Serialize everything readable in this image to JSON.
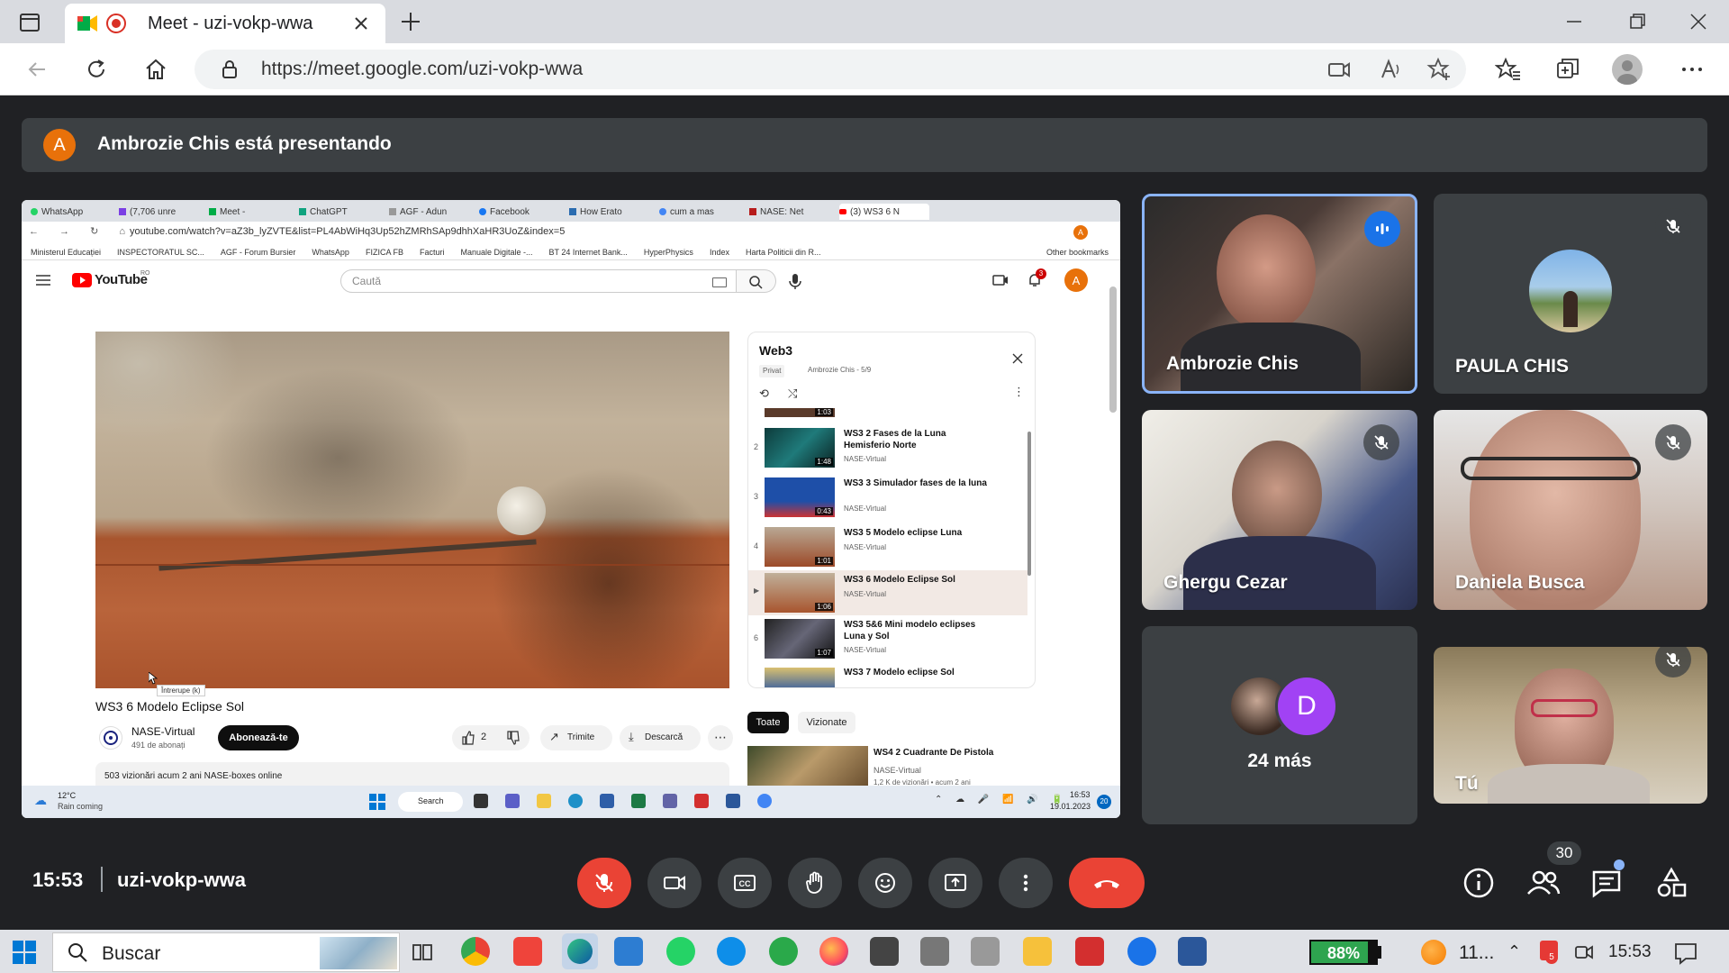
{
  "browser": {
    "tab_title": "Meet - uzi-vokp-wwa",
    "url": "https://meet.google.com/uzi-vokp-wwa"
  },
  "banner": {
    "avatar_letter": "A",
    "text": "Ambrozie Chis está presentando"
  },
  "shared_screen": {
    "tabs": [
      "WhatsApp",
      "(7,706 unre",
      "Meet -",
      "ChatGPT",
      "AGF - Adun",
      "Facebook",
      "How Erato",
      "cum a mas",
      "NASE: Net",
      "(3) WS3 6 N"
    ],
    "url": "youtube.com/watch?v=aZ3b_lyZVTE&list=PL4AbWiHq3Up52hZMRhSAp9dhhXaHR3UoZ&index=5",
    "bookmarks": [
      "Ministerul Educației",
      "INSPECTORATUL SC...",
      "AGF - Forum Bursier",
      "WhatsApp",
      "FIZICA FB",
      "Facturi",
      "Manuale Digitale -...",
      "BT 24 Internet Bank...",
      "HyperPhysics",
      "Index",
      "Harta Politicii din R..."
    ],
    "other_bookmarks": "Other bookmarks",
    "youtube_logo": "YouTube",
    "youtube_region": "RO",
    "search_placeholder": "Caută",
    "account_letter": "A",
    "notif_count": "3",
    "tooltip": "Întrerupe (k)",
    "video_title": "WS3 6 Modelo Eclipse Sol",
    "channel": "NASE-Virtual",
    "subscribers": "491 de abonați",
    "subscribe": "Abonează-te",
    "likes": "2",
    "share": "Trimite",
    "download": "Descarcă",
    "views": "503 vizionări  acum 2 ani  NASE-boxes online",
    "playlist": {
      "title": "Web3",
      "privacy": "Privat",
      "owner": "Ambrozie Chis - 5/9",
      "top_duration": "1:03",
      "items": [
        {
          "index": "2",
          "title": "WS3 2 Fases de la Luna Hemisferio Norte",
          "channel": "NASE-Virtual",
          "duration": "1:48"
        },
        {
          "index": "3",
          "title": "WS3 3 Simulador fases de la luna",
          "channel": "NASE-Virtual",
          "duration": "0:43"
        },
        {
          "index": "4",
          "title": "WS3 5 Modelo eclipse Luna",
          "channel": "NASE-Virtual",
          "duration": "1:01"
        },
        {
          "index": "▶",
          "title": "WS3 6 Modelo Eclipse Sol",
          "channel": "NASE-Virtual",
          "duration": "1:06"
        },
        {
          "index": "6",
          "title": "WS3 5&6 Mini modelo eclipses Luna y Sol",
          "channel": "NASE-Virtual",
          "duration": "1:07"
        },
        {
          "index": "7",
          "title": "WS3 7 Modelo eclipse Sol",
          "channel": "",
          "duration": ""
        }
      ]
    },
    "filter_all": "Toate",
    "filter_watched": "Vizionate",
    "related_title": "WS4 2 Cuadrante De Pistola",
    "related_channel": "NASE-Virtual",
    "related_meta": "1,2 K de vizionări • acum 2 ani",
    "weather_temp": "12°C",
    "weather_text": "Rain coming",
    "win_search": "Search",
    "clock_time": "16:53",
    "clock_date": "19.01.2023",
    "notif_badge": "20"
  },
  "participants": {
    "p1": "Ambrozie Chis",
    "p2": "PAULA CHIS",
    "p3": "Ghergu Cezar",
    "p4": "Daniela Busca",
    "more_letter": "D",
    "more": "24 más",
    "self": "Tú"
  },
  "bottom": {
    "time": "15:53",
    "meeting_code": "uzi-vokp-wwa",
    "people_count": "30"
  },
  "taskbar": {
    "search": "Buscar",
    "battery": "88%",
    "weather": "11...",
    "time": "15:53",
    "badge": "5"
  },
  "colors": {
    "meet_bg": "#202124",
    "surface": "#3c4043",
    "end_call": "#ea4335",
    "accent_blue": "#8ab4f8",
    "avatar_orange": "#e8710a",
    "youtube_red": "#ff0000"
  }
}
